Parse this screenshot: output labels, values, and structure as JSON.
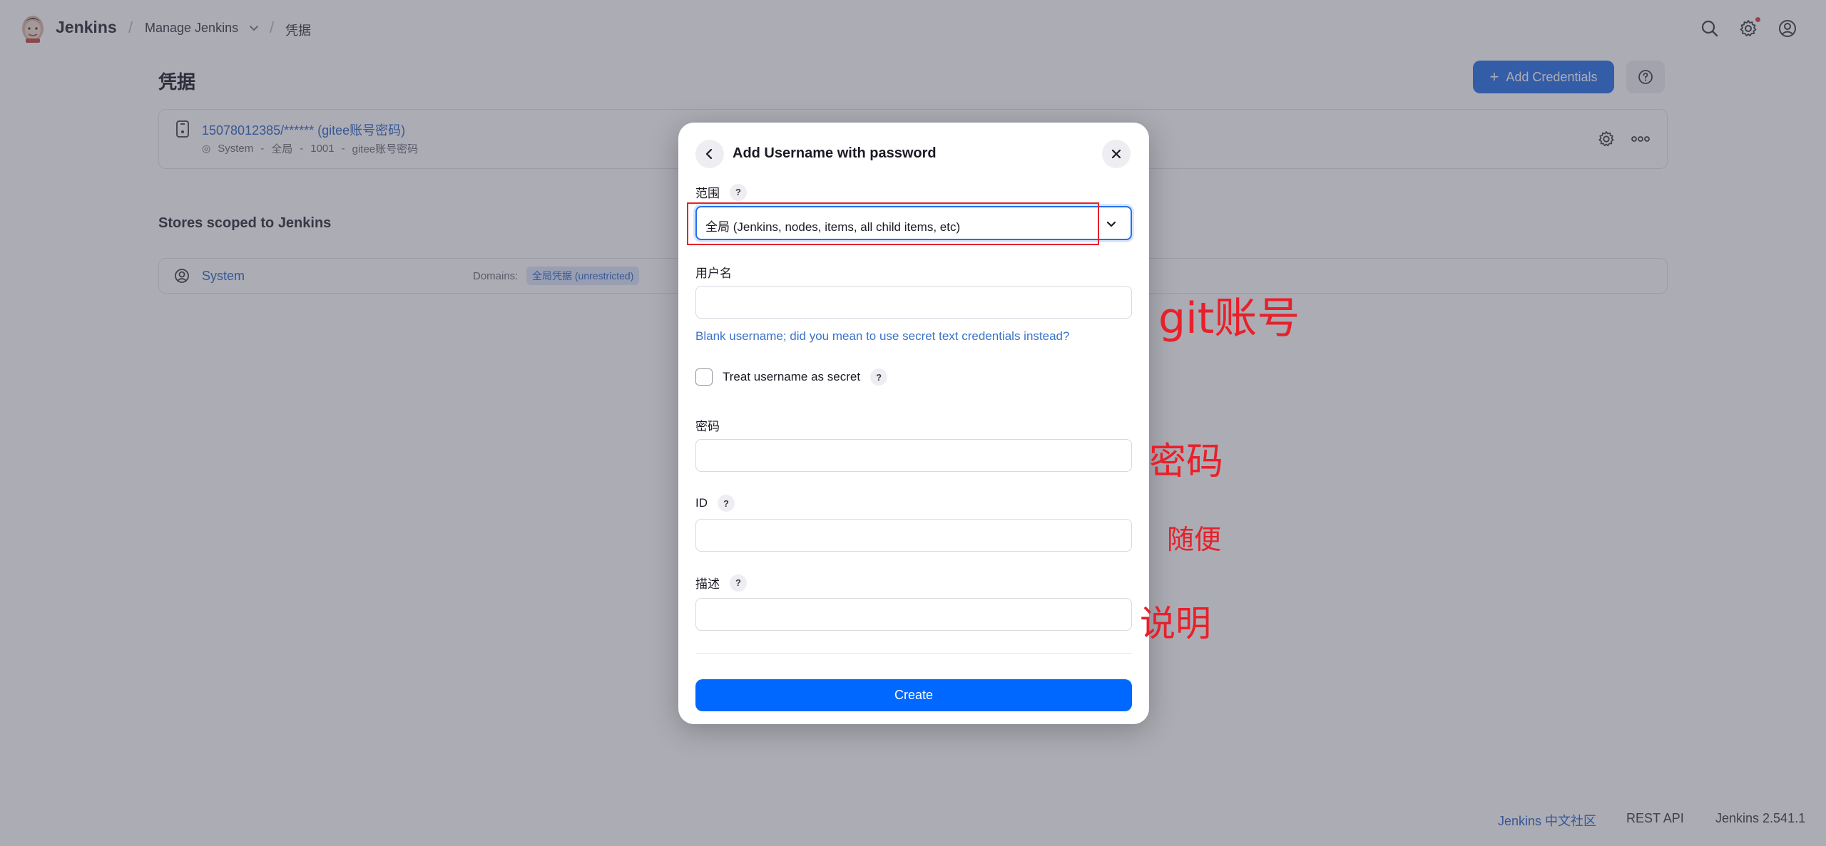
{
  "header": {
    "brand": "Jenkins",
    "breadcrumbs": [
      "Manage Jenkins",
      "凭据"
    ]
  },
  "page": {
    "title": "凭据",
    "add_button": "Add Credentials"
  },
  "credential": {
    "title": "15078012385/****** (gitee账号密码)",
    "meta": [
      "System",
      "全局",
      "1001",
      "gitee账号密码"
    ]
  },
  "stores": {
    "heading": "Stores scoped to Jenkins",
    "row": {
      "name": "System",
      "domains_label": "Domains:",
      "domain_badge": "全局凭据 (unrestricted)"
    }
  },
  "dialog": {
    "title": "Add Username with password",
    "scope_label": "范围",
    "scope_value": "全局 (Jenkins, nodes, items, all child items, etc)",
    "username_label": "用户名",
    "username_value": "",
    "blank_hint": "Blank username; did you mean to use secret text credentials instead?",
    "treat_secret_label": "Treat username as secret",
    "treat_secret_checked": false,
    "password_label": "密码",
    "password_value": "",
    "id_label": "ID",
    "id_value": "",
    "description_label": "描述",
    "description_value": "",
    "create_button": "Create",
    "help_glyph": "?"
  },
  "annotations": {
    "username": "git账号",
    "password": "密码",
    "id": "随便",
    "description": "说明"
  },
  "footer": {
    "community": "Jenkins 中文社区",
    "rest_api": "REST API",
    "version": "Jenkins 2.541.1"
  },
  "colors": {
    "accent": "#2570ea",
    "primary_button": "#0068ff",
    "link": "#2c66c7",
    "annotation_red": "#e8202a"
  }
}
